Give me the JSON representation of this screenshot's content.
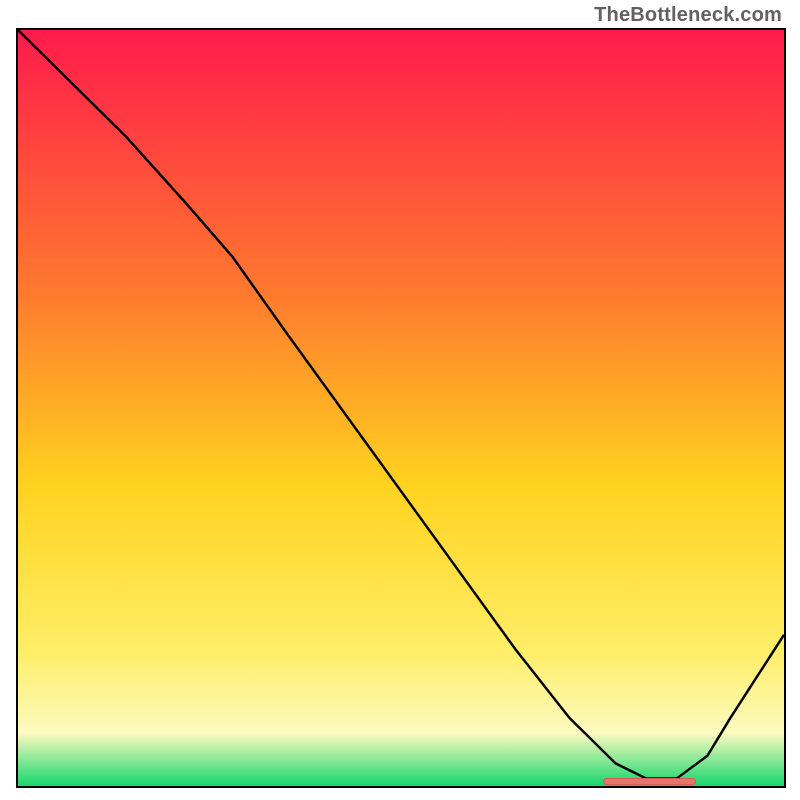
{
  "watermark": "TheBottleneck.com",
  "colors": {
    "gradient_top": "#ff1b4b",
    "gradient_mid1": "#ff7a2e",
    "gradient_mid2": "#ffd21f",
    "gradient_mid3": "#ffee66",
    "gradient_mid4": "#fcfac0",
    "gradient_bottom": "#17d66c",
    "curve": "#000000",
    "marker": "#e6766c"
  },
  "chart_data": {
    "type": "line",
    "title": "",
    "xlabel": "",
    "ylabel": "",
    "xlim": [
      0,
      100
    ],
    "ylim": [
      0,
      100
    ],
    "series": [
      {
        "name": "curve",
        "x": [
          0,
          6,
          14,
          22,
          28,
          35,
          45,
          55,
          65,
          72,
          78,
          82,
          86,
          90,
          93,
          100
        ],
        "y": [
          100,
          94,
          86,
          77,
          70,
          60,
          46,
          32,
          18,
          9,
          3,
          1,
          1,
          4,
          9,
          20
        ]
      }
    ],
    "annotations": [
      {
        "name": "bottleneck-marker",
        "x_start": 76,
        "x_end": 88,
        "y": 1
      }
    ]
  }
}
